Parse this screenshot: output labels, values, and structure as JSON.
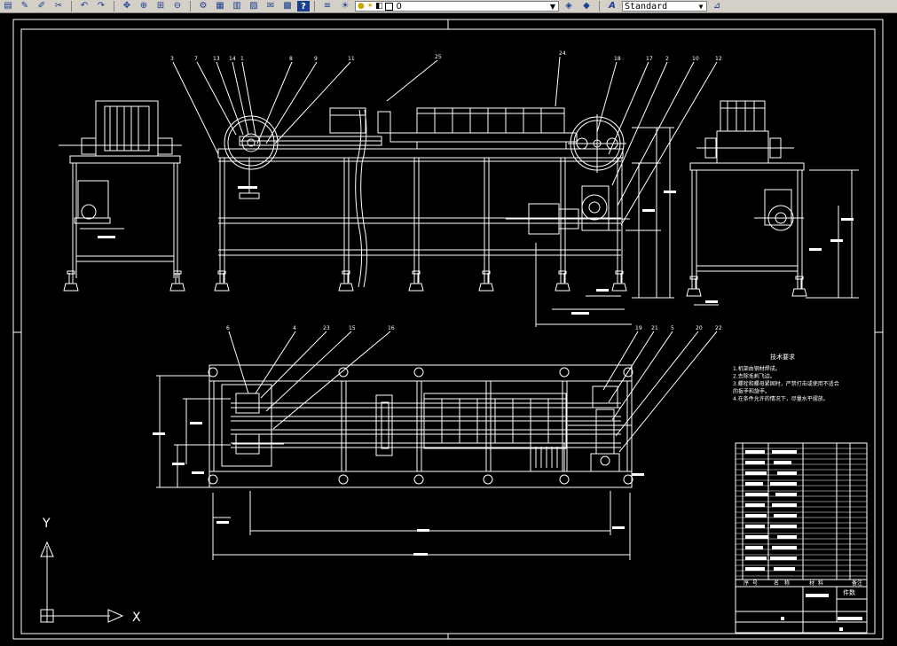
{
  "toolbar": {
    "buttons": [
      {
        "name": "open-icon",
        "glyph": "▤"
      },
      {
        "name": "save-icon",
        "glyph": "✎"
      },
      {
        "name": "pencil-icon",
        "glyph": "✐"
      },
      {
        "name": "match-properties-icon",
        "glyph": "✂"
      }
    ],
    "nav_buttons": [
      {
        "name": "undo-icon",
        "glyph": "↶"
      },
      {
        "name": "redo-icon",
        "glyph": "↷"
      }
    ],
    "view_buttons": [
      {
        "name": "pan-icon",
        "glyph": "✥"
      },
      {
        "name": "zoom-realtime-icon",
        "glyph": "⊕"
      },
      {
        "name": "zoom-window-icon",
        "glyph": "⊞"
      },
      {
        "name": "zoom-previous-icon",
        "glyph": "⊖"
      }
    ],
    "tool_buttons": [
      {
        "name": "properties-icon",
        "glyph": "⚙"
      },
      {
        "name": "design-center-icon",
        "glyph": "▦"
      },
      {
        "name": "tool-palettes-icon",
        "glyph": "▥"
      },
      {
        "name": "sheet-set-icon",
        "glyph": "▨"
      },
      {
        "name": "markup-icon",
        "glyph": "✉"
      },
      {
        "name": "calculator-icon",
        "glyph": "▩"
      }
    ],
    "help_label": "?",
    "layer_current": "0",
    "text_style_current": "Standard"
  },
  "drawing": {
    "part_numbers_top": [
      "3",
      "7",
      "13",
      "14",
      "1",
      "8",
      "9",
      "11",
      "25",
      "24",
      "18",
      "17",
      "2",
      "10",
      "12"
    ],
    "part_numbers_bottom": [
      "6",
      "4",
      "23",
      "15",
      "16",
      "19",
      "21",
      "5",
      "20",
      "22"
    ],
    "tech_req_title": "技术要求",
    "tech_req_lines": [
      "1.机架由钢材焊成。",
      "2.去除毛刺飞边。",
      "3.螺栓和螺母紧固时，严禁打击或使用不适合",
      "的扳手和旋手。",
      "4.在条件允许的情况下，尽量水平摆放。"
    ],
    "title_block_row_labels": [
      "序",
      "号",
      "名",
      "称",
      "材",
      "料",
      "备注"
    ],
    "title_block_material_label": "件数",
    "ucs_x_label": "X",
    "ucs_y_label": "Y",
    "colors": {
      "background": "#000000",
      "lines": "#ffffff"
    }
  }
}
